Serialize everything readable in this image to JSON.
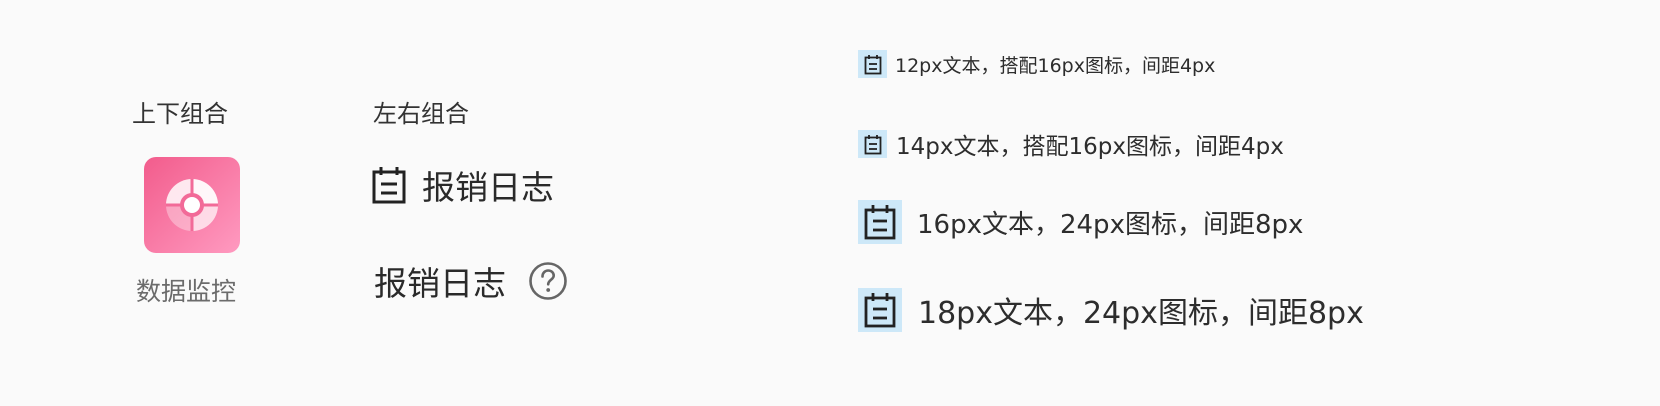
{
  "vertical_combo": {
    "heading": "上下组合",
    "tile_icon": "pie-monitor-icon",
    "caption": "数据监控",
    "tile_gradient_from": "#f25c8c",
    "tile_gradient_to": "#ff9ac0"
  },
  "horizontal_combo": {
    "heading": "左右组合",
    "icon_first_label": "报销日志",
    "text_first_label": "报销日志",
    "leading_icon": "calendar-icon",
    "trailing_icon": "help-circle-icon"
  },
  "specs": {
    "icon": "calendar-icon",
    "highlight_color": "#cde8f8",
    "rows": [
      {
        "label": "12px文本，搭配16px图标，间距4px"
      },
      {
        "label": "14px文本，搭配16px图标，间距4px"
      },
      {
        "label": "16px文本，24px图标，间距8px"
      },
      {
        "label": "18px文本，24px图标，间距8px"
      }
    ]
  }
}
